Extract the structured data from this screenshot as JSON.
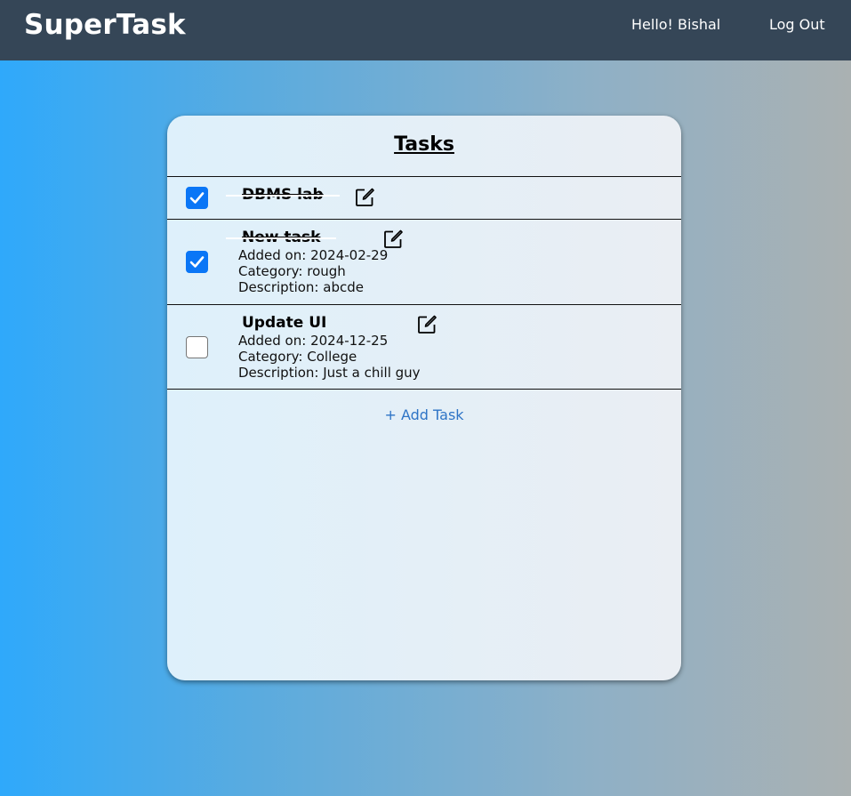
{
  "app": {
    "brand": "SuperTask"
  },
  "nav": {
    "greeting": "Hello! Bishal",
    "logout_label": "Log Out"
  },
  "card": {
    "title": "Tasks",
    "add_task_label": "+ Add Task"
  },
  "tasks": [
    {
      "name": "DBMS lab",
      "done": true
    },
    {
      "name": "New task",
      "done": true,
      "added": "Added on: 2024-02-29",
      "category": "Category: rough",
      "description": "Description: abcde"
    },
    {
      "name": "Update UI",
      "done": false,
      "added": "Added on: 2024-12-25",
      "category": "Category: College",
      "description": "Description: Just a chill guy"
    }
  ],
  "icons": {
    "check": "checkmark-icon",
    "edit": "edit-icon"
  },
  "colors": {
    "navbar": "#354657",
    "checkbox_checked": "#0a76f6",
    "link": "#2e74c6"
  }
}
